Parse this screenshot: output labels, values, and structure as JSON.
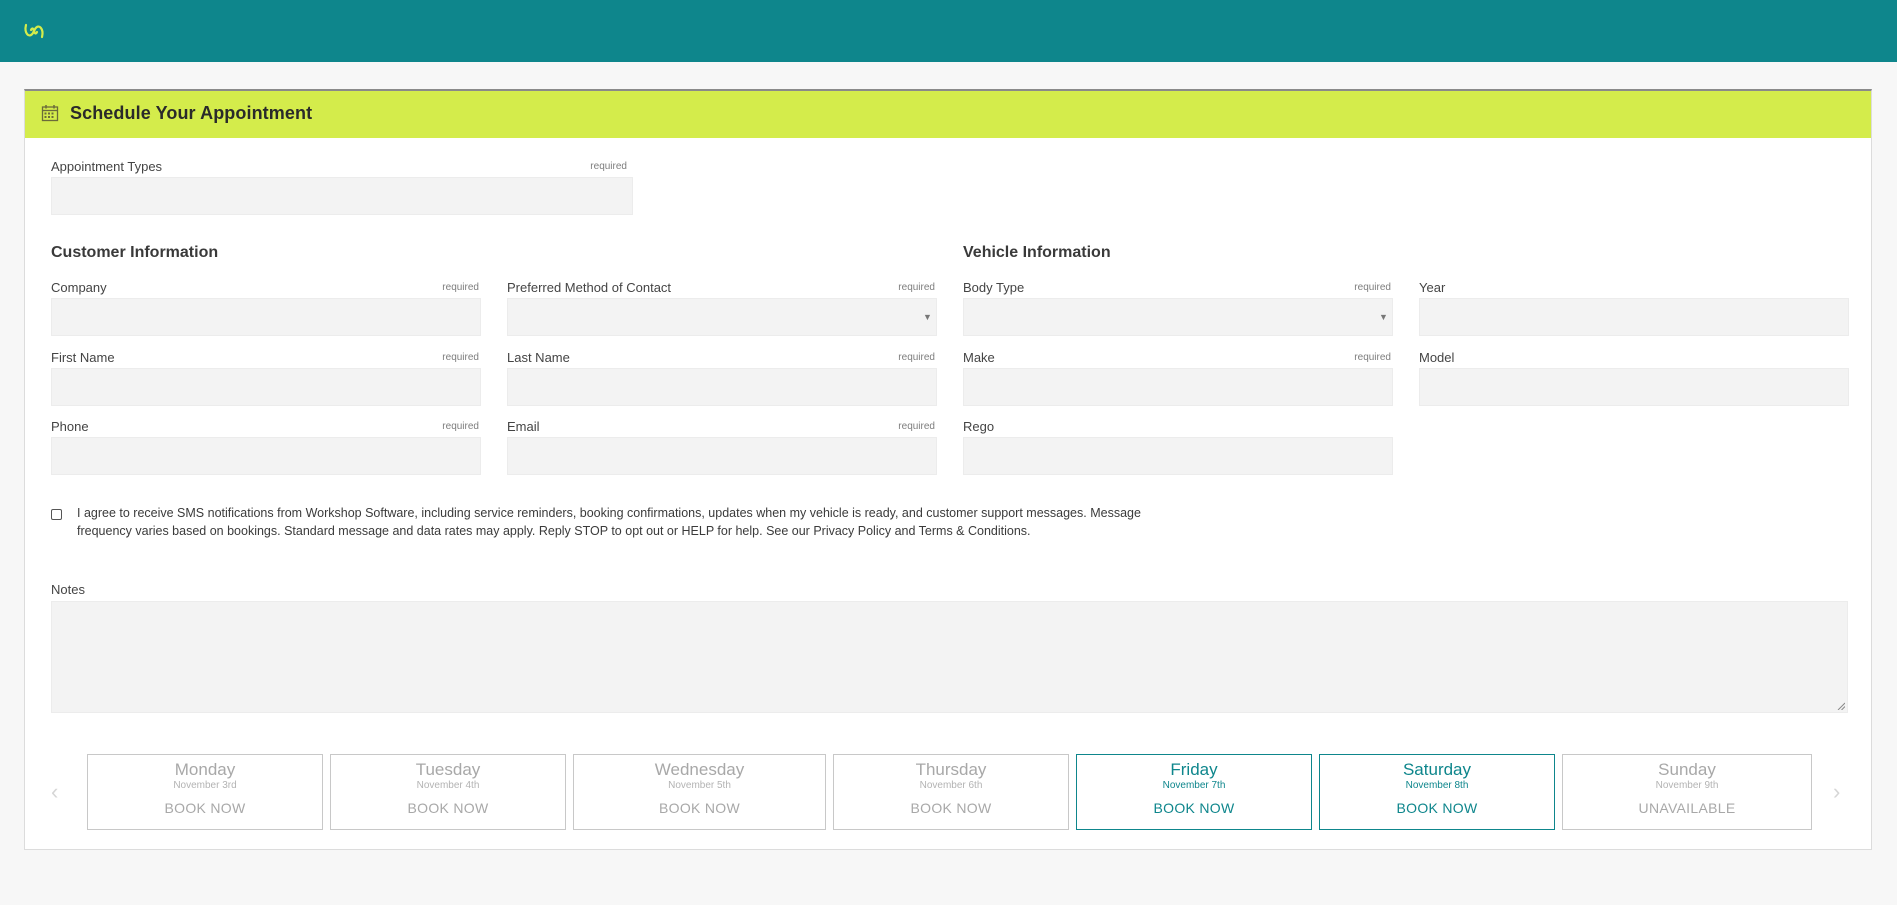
{
  "brand_color": "#0e868c",
  "accent_color": "#d4ec4b",
  "header": {
    "logo_icon": "brand-logo-icon"
  },
  "card": {
    "title": "Schedule Your Appointment",
    "title_icon": "calendar-icon"
  },
  "appointment_types": {
    "label": "Appointment Types",
    "required": "required",
    "value": ""
  },
  "customer": {
    "title": "Customer Information",
    "company": {
      "label": "Company",
      "required": "required",
      "value": ""
    },
    "contact_method": {
      "label": "Preferred Method of Contact",
      "required": "required",
      "value": ""
    },
    "first_name": {
      "label": "First Name",
      "required": "required",
      "value": ""
    },
    "last_name": {
      "label": "Last Name",
      "required": "required",
      "value": ""
    },
    "phone": {
      "label": "Phone",
      "required": "required",
      "value": ""
    },
    "email": {
      "label": "Email",
      "required": "required",
      "value": ""
    }
  },
  "vehicle": {
    "title": "Vehicle Information",
    "body_type": {
      "label": "Body Type",
      "required": "required",
      "value": ""
    },
    "year": {
      "label": "Year",
      "value": ""
    },
    "make": {
      "label": "Make",
      "required": "required",
      "value": ""
    },
    "model": {
      "label": "Model",
      "value": ""
    },
    "rego": {
      "label": "Rego",
      "value": ""
    }
  },
  "consent": {
    "checked": false,
    "line1": "I agree to receive SMS notifications from Workshop Software, including service reminders, booking confirmations, updates when my vehicle is ready, and customer support messages. Message",
    "line2": "frequency varies based on bookings. Standard message and data rates may apply. Reply STOP to opt out or HELP for help. See our Privacy Policy and Terms & Conditions."
  },
  "notes": {
    "label": "Notes",
    "value": ""
  },
  "days": [
    {
      "name": "Monday",
      "date": "November 3rd",
      "action": "BOOK NOW",
      "available": false
    },
    {
      "name": "Tuesday",
      "date": "November 4th",
      "action": "BOOK NOW",
      "available": false
    },
    {
      "name": "Wednesday",
      "date": "November 5th",
      "action": "BOOK NOW",
      "available": false
    },
    {
      "name": "Thursday",
      "date": "November 6th",
      "action": "BOOK NOW",
      "available": false
    },
    {
      "name": "Friday",
      "date": "November 7th",
      "action": "BOOK NOW",
      "available": true
    },
    {
      "name": "Saturday",
      "date": "November 8th",
      "action": "BOOK NOW",
      "available": true
    },
    {
      "name": "Sunday",
      "date": "November 9th",
      "action": "UNAVAILABLE",
      "available": false
    }
  ]
}
